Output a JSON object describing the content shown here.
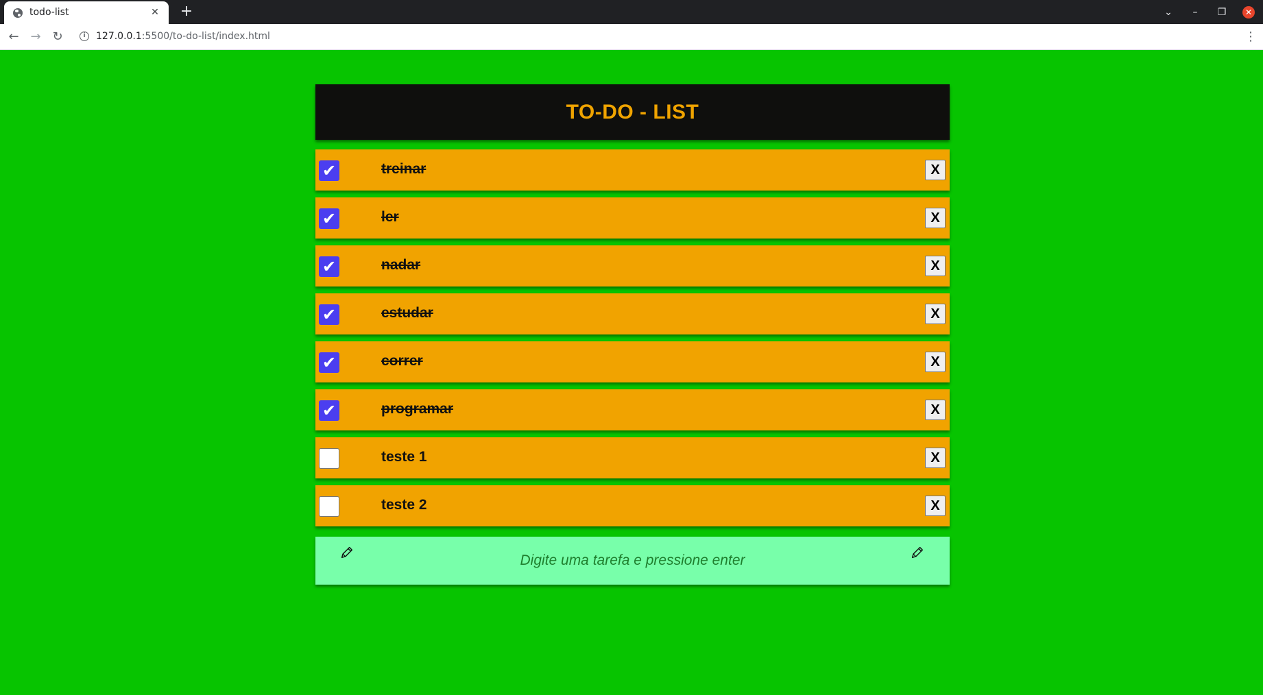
{
  "browser": {
    "tab_title": "todo-list",
    "tab_close": "✕",
    "new_tab": "+",
    "url_host": "127.0.0.1",
    "url_rest": ":5500/to-do-list/index.html",
    "back": "←",
    "forward": "→",
    "reload": "↻",
    "menu": "⋮",
    "win_dropdown": "⌄",
    "win_minimize": "–",
    "win_restore": "❐",
    "win_close": "✕"
  },
  "app": {
    "title": "TO-DO - LIST",
    "delete_label": "X",
    "check_mark": "✔",
    "items": [
      {
        "text": "treinar",
        "done": true
      },
      {
        "text": "ler",
        "done": true
      },
      {
        "text": "nadar",
        "done": true
      },
      {
        "text": "estudar",
        "done": true
      },
      {
        "text": "correr",
        "done": true
      },
      {
        "text": "programar",
        "done": true
      },
      {
        "text": "teste 1",
        "done": false
      },
      {
        "text": "teste 2",
        "done": false
      }
    ],
    "input": {
      "placeholder": "Digite uma tarefa e pressione enter",
      "value": ""
    },
    "icons": {
      "left": "pencil-icon",
      "right": "pencil-icon"
    }
  },
  "colors": {
    "page_bg": "#07c400",
    "header_bg": "#0f0f0d",
    "title": "#f0a400",
    "item_bg": "#f1a300",
    "checkbox_checked": "#4b3ef0",
    "input_bg": "#78ffaa"
  }
}
